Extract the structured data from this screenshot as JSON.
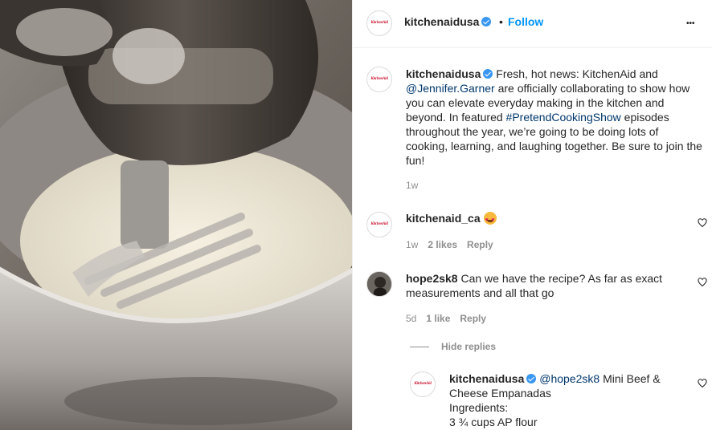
{
  "post": {
    "author": "kitchenaidusa",
    "separator": "•",
    "follow_label": "Follow",
    "more_label": "•••",
    "avatar_text": "KitchenAid"
  },
  "caption": {
    "author": "kitchenaidusa",
    "text_1": "Fresh, hot news: KitchenAid and",
    "mention": "@Jennifer.Garner",
    "text_2": " are officially collaborating to show how you can elevate everyday making in the kitchen and beyond. In featured ",
    "hashtag": "#PretendCookingShow",
    "text_3": " episodes throughout the year, we’re going to be doing lots of cooking, learning, and laughing together. Be sure to join the fun!",
    "time": "1w"
  },
  "comments": [
    {
      "author": "kitchenaid_ca",
      "emoji": "heart-eyes-emoji",
      "time": "1w",
      "likes": "2 likes",
      "reply": "Reply",
      "avatar_text": "KitchenAid"
    },
    {
      "author": "hope2sk8",
      "text": "Can we have the recipe? As far as exact measurements and all that go",
      "time": "5d",
      "likes": "1 like",
      "reply": "Reply"
    }
  ],
  "hide_replies": "Hide replies",
  "reply": {
    "author": "kitchenaidusa",
    "mention": "@hope2sk8",
    "text_1": " Mini Beef & Cheese Empanadas",
    "line_2": "Ingredients:",
    "line_3": "3 ¾ cups AP flour",
    "avatar_text": "KitchenAid"
  },
  "colors": {
    "link": "#00376b",
    "follow": "#0095f6",
    "verified": "#3897f0",
    "muted": "#8e8e8e"
  }
}
